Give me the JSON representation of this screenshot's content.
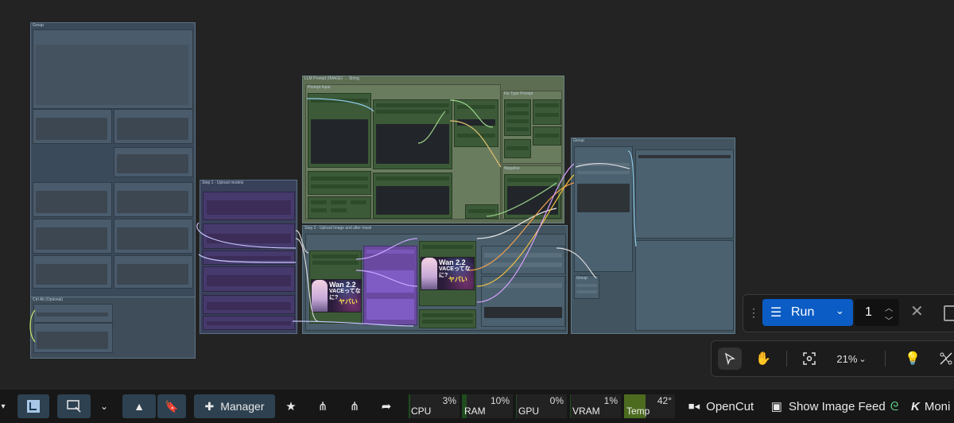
{
  "canvas": {
    "group_labels": {
      "left_group": "Group",
      "left_sub": "Ctrl Alt (Optional)",
      "upload_models": "Step 1 - Upload models",
      "llm_prompt": "LLM Prompt (IMAGE) → String",
      "prompt_input": "Prompt Input",
      "fix_type_prompt": "Fix Type Prompt",
      "negative": "Negative",
      "upload_image": "Step 2 - Upload Image and alter mask",
      "right_group": "Group",
      "right_sub": "Group"
    },
    "previews": [
      {
        "line1": "Wan 2.2",
        "line2": "VACEってなに?",
        "line3": "ヤバい"
      },
      {
        "line1": "Wan 2.2",
        "line2": "VACEってなに?",
        "line3": "ヤバい"
      }
    ]
  },
  "run_widget": {
    "drag_icon": "drag-handle-icon",
    "run_label": "Run",
    "queue_count": "1",
    "cancel_icon": "close-icon",
    "stop_icon": "square-icon"
  },
  "canvas_tools": {
    "select_icon": "pointer-icon",
    "pan_icon": "hand-icon",
    "fit_icon": "fit-view-icon",
    "zoom": "21%",
    "hint_icon": "lightbulb-icon",
    "links_icon": "hide-links-icon"
  },
  "bottom_bar": {
    "manager_label": "Manager",
    "meters": [
      {
        "name": "CPU",
        "value": "3%",
        "fill": 3
      },
      {
        "name": "RAM",
        "value": "10%",
        "fill": 10
      },
      {
        "name": "GPU",
        "value": "0%",
        "fill": 0
      },
      {
        "name": "VRAM",
        "value": "1%",
        "fill": 1
      },
      {
        "name": "Temp",
        "value": "42°",
        "fill": 42
      }
    ],
    "opencut_label": "OpenCut",
    "image_feed_label": "Show Image Feed",
    "monitor_label": "Moni"
  },
  "colors": {
    "accent": "#0b5cc4",
    "canvas_bg": "#232323",
    "meter_fill": "#1f4c1f"
  }
}
